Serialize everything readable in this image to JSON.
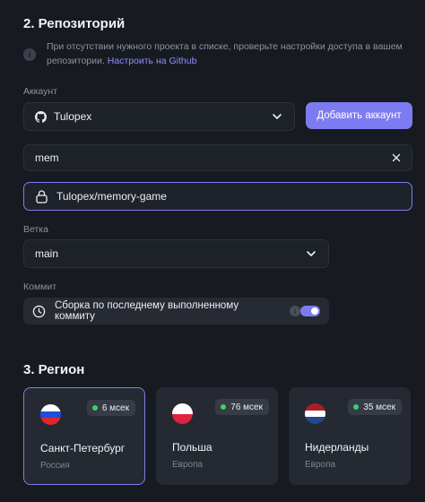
{
  "repository": {
    "section_title": "2. Репозиторий",
    "info_text": "При отсутствии нужного проекта в списке, проверьте настройки доступа в вашем репозитории.",
    "info_link": "Настроить на Github",
    "account_label": "Аккаунт",
    "account_value": "Tulopex",
    "add_account_button": "Добавить аккаунт",
    "search_value": "mem",
    "selected_repo": "Tulopex/memory-game",
    "branch_label": "Ветка",
    "branch_value": "main",
    "commit_label": "Коммит",
    "commit_option": "Сборка по последнему выполненному коммиту",
    "commit_toggle_on": true
  },
  "region": {
    "section_title": "3. Регион",
    "cards": [
      {
        "name": "Санкт-Петербург",
        "sub": "Россия",
        "ping": "6 мсек",
        "flag": [
          "#ffffff",
          "#1d4fd8",
          "#e0262c"
        ],
        "selected": true
      },
      {
        "name": "Польша",
        "sub": "Европа",
        "ping": "76 мсек",
        "flag": [
          "#ffffff",
          "#dc2340"
        ],
        "selected": false
      },
      {
        "name": "Нидерланды",
        "sub": "Европа",
        "ping": "35 мсек",
        "flag": [
          "#ae1c28",
          "#ffffff",
          "#21468b"
        ],
        "selected": false
      }
    ]
  },
  "colors": {
    "accent": "#7d7bf1",
    "ping_ok": "#3bd16f",
    "background": "#171b21"
  }
}
